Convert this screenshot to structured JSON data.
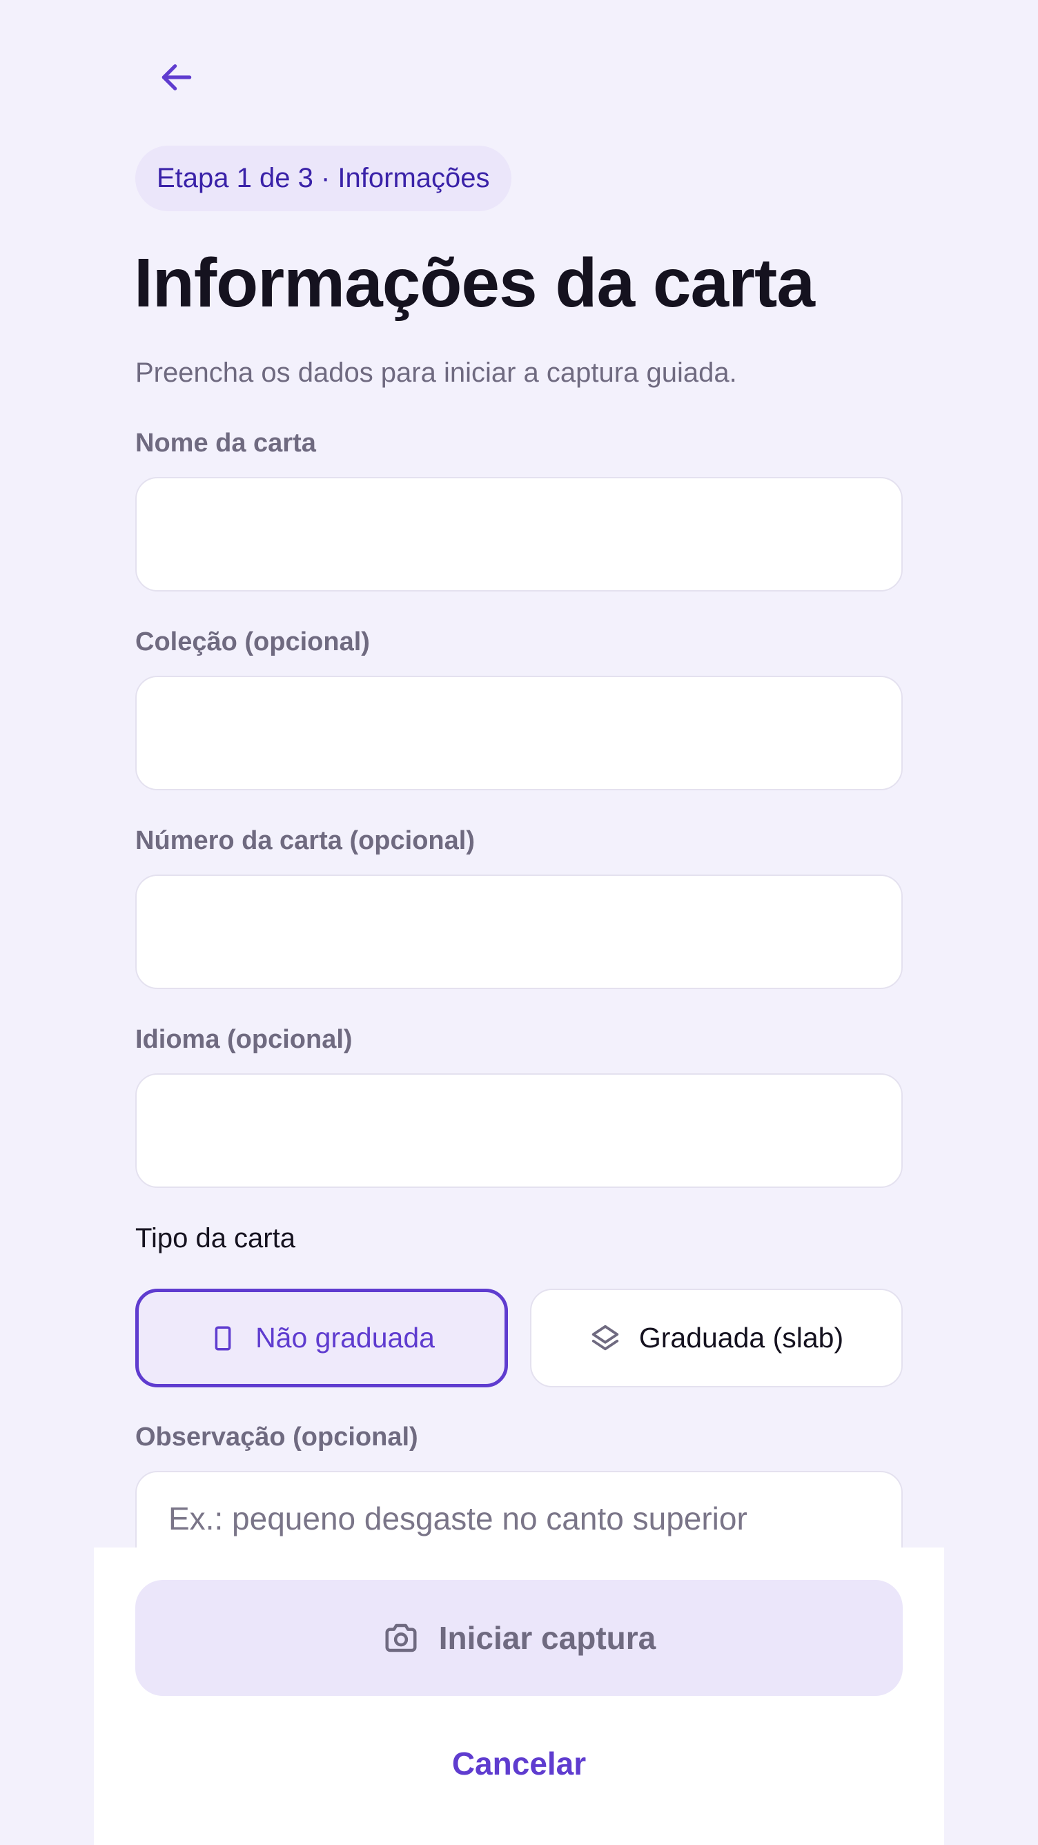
{
  "header": {
    "back_icon": "arrow-left-icon",
    "step_label": "Etapa 1 de 3 · Informações"
  },
  "title": "Informações da carta",
  "subtitle": "Preencha os dados para iniciar a captura guiada.",
  "fields": {
    "name": {
      "label": "Nome da carta",
      "value": "",
      "placeholder": ""
    },
    "collection": {
      "label": "Coleção (opcional)",
      "value": "",
      "placeholder": ""
    },
    "number": {
      "label": "Número da carta (opcional)",
      "value": "",
      "placeholder": ""
    },
    "language": {
      "label": "Idioma (opcional)",
      "value": "",
      "placeholder": ""
    }
  },
  "card_type": {
    "label": "Tipo da carta",
    "options": [
      {
        "label": "Não graduada",
        "icon": "card-icon",
        "selected": true
      },
      {
        "label": "Graduada (slab)",
        "icon": "layers-icon",
        "selected": false
      }
    ]
  },
  "observation": {
    "label": "Observação (opcional)",
    "placeholder": "Ex.: pequeno desgaste no canto superior"
  },
  "actions": {
    "start_label": "Iniciar captura",
    "start_icon": "camera-icon",
    "cancel_label": "Cancelar"
  },
  "colors": {
    "background": "#f3f1fc",
    "accent": "#5f3ccf",
    "pill_bg": "#ebe6fa",
    "text_primary": "#15121f",
    "text_secondary": "#6f6a80"
  }
}
